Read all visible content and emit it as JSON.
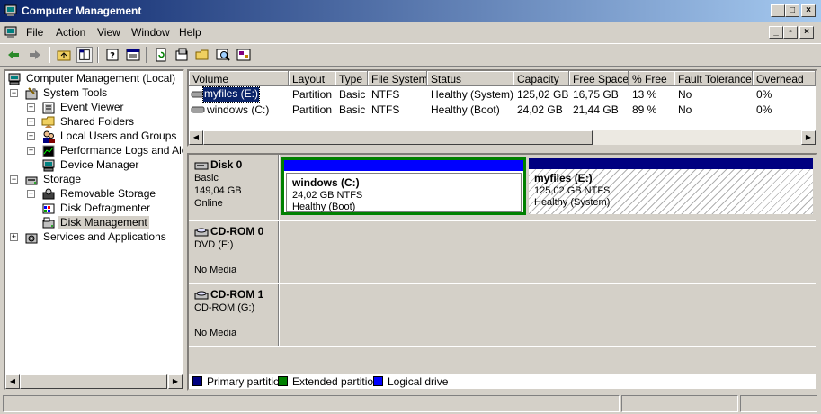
{
  "window": {
    "title": "Computer Management",
    "controls": [
      "_",
      "□",
      "×"
    ]
  },
  "menu": {
    "items": [
      {
        "label": "File"
      },
      {
        "label": "Action"
      },
      {
        "label": "View"
      },
      {
        "label": "Window"
      },
      {
        "label": "Help"
      }
    ],
    "mdi_controls": [
      "_",
      "▫",
      "×"
    ]
  },
  "toolbar": {
    "buttons": [
      "back-icon",
      "forward-icon",
      "up-folder-icon",
      "show-tree-icon",
      "help-icon",
      "console-icon",
      "refresh-icon",
      "properties-icon",
      "open-icon",
      "search-icon",
      "settings-icon"
    ]
  },
  "tree": {
    "items": [
      {
        "label": "Computer Management (Local)",
        "icon": "computer-icon"
      },
      {
        "label": "System Tools",
        "icon": "tools-icon"
      },
      {
        "label": "Event Viewer",
        "icon": "event-viewer-icon"
      },
      {
        "label": "Shared Folders",
        "icon": "shared-folder-icon"
      },
      {
        "label": "Local Users and Groups",
        "icon": "users-icon"
      },
      {
        "label": "Performance Logs and Alerts",
        "icon": "performance-icon"
      },
      {
        "label": "Device Manager",
        "icon": "device-manager-icon"
      },
      {
        "label": "Storage",
        "icon": "storage-icon"
      },
      {
        "label": "Removable Storage",
        "icon": "removable-storage-icon"
      },
      {
        "label": "Disk Defragmenter",
        "icon": "defrag-icon"
      },
      {
        "label": "Disk Management",
        "icon": "disk-management-icon"
      },
      {
        "label": "Services and Applications",
        "icon": "services-icon"
      }
    ]
  },
  "volumes": {
    "columns": [
      "Volume",
      "Layout",
      "Type",
      "File System",
      "Status",
      "Capacity",
      "Free Space",
      "% Free",
      "Fault Tolerance",
      "Overhead"
    ],
    "rows": [
      [
        "myfiles (E:)",
        "Partition",
        "Basic",
        "NTFS",
        "Healthy (System)",
        "125,02 GB",
        "16,75 GB",
        "13 %",
        "No",
        "0%"
      ],
      [
        "windows (C:)",
        "Partition",
        "Basic",
        "NTFS",
        "Healthy (Boot)",
        "24,02 GB",
        "21,44 GB",
        "89 %",
        "No",
        "0%"
      ]
    ]
  },
  "disks": [
    {
      "name": "Disk 0",
      "line2": "Basic",
      "line3": "149,04 GB",
      "line4": "Online",
      "partitions": [
        {
          "title": "windows  (C:)",
          "size": "24,02 GB NTFS",
          "status": "Healthy (Boot)",
          "color": "#0000ff"
        },
        {
          "title": "myfiles  (E:)",
          "size": "125,02 GB NTFS",
          "status": "Healthy (System)",
          "color": "#000080"
        }
      ]
    },
    {
      "name": "CD-ROM 0",
      "line2": "DVD (F:)",
      "line3": "",
      "line4": "No Media"
    },
    {
      "name": "CD-ROM 1",
      "line2": "CD-ROM (G:)",
      "line3": "",
      "line4": "No Media"
    }
  ],
  "legend": [
    {
      "label": "Primary partition",
      "color": "#000080"
    },
    {
      "label": "Extended partition",
      "color": "#008000"
    },
    {
      "label": "Logical drive",
      "color": "#0000ff"
    }
  ],
  "colors": {
    "selection_border": "#008000"
  }
}
